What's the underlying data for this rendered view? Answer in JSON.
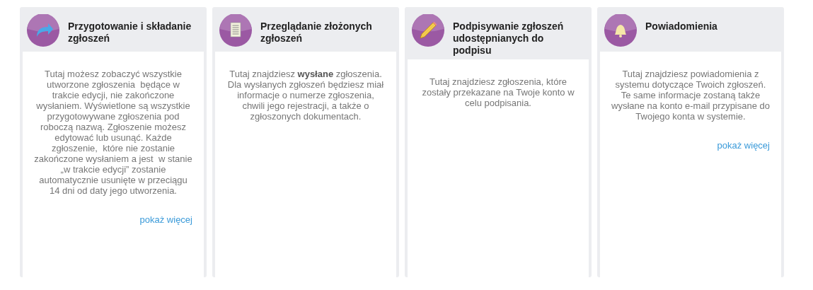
{
  "cards": [
    {
      "kind": "share",
      "title": "Przygotowanie i składanie zgłoszeń",
      "text": "Tutaj możesz zobaczyć wszystkie utworzone zgłoszenia  będące w trakcie edycji, nie zakończone wysłaniem. Wyświetlone są wszystkie przygotowywane zgłoszenia pod roboczą nazwą. Zgłoszenie możesz edytować lub usunąć. Każde zgłoszenie,  które nie zostanie zakończone wysłaniem a jest  w stanie „w trakcie edycji” zostanie automatycznie usunięte w przeciągu 14 dni od daty jego utworzenia.",
      "link": "pokaż więcej"
    },
    {
      "kind": "document",
      "title": "Przeglądanie złożonych zgłoszeń",
      "text": "Tutaj znajdziesz **wysłane** zgłoszenia. Dla wysłanych zgłoszeń będziesz miał informacje o numerze zgłoszenia, chwili jego rejestracji, a także o zgłoszonych dokumentach."
    },
    {
      "kind": "pencil",
      "title": "Podpisywanie zgłoszeń udostępnianych do podpisu",
      "text": "Tutaj znajdziesz zgłoszenia, które zostały przekazane na Twoje konto w celu podpisania."
    },
    {
      "kind": "bell",
      "title": "Powiadomienia",
      "text": "Tutaj znajdziesz powiadomienia z systemu dotyczące Twoich zgłoszeń. Te same informacje zostaną także wysłane na konto e-mail przypisane do Twojego konta w systemie.",
      "link": "pokaż więcej"
    }
  ]
}
